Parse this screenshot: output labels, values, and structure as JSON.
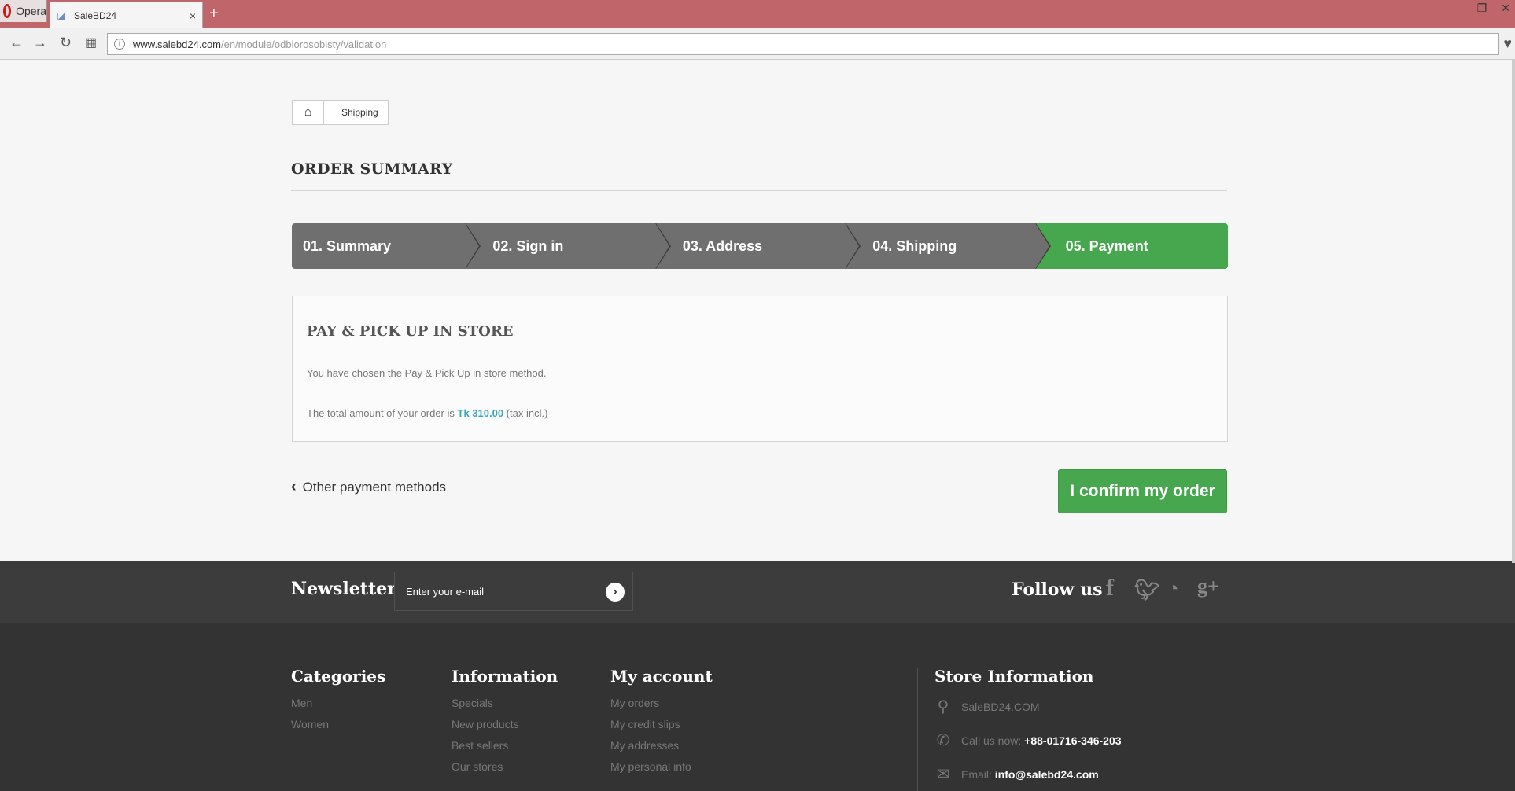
{
  "browser": {
    "app_name": "Opera",
    "tab_title": "SaleBD24",
    "url_host": "www.salebd24.com",
    "url_path": "/en/module/odbiorosobisty/validation"
  },
  "breadcrumb": {
    "current": "Shipping"
  },
  "page": {
    "heading": "ORDER SUMMARY",
    "steps": [
      {
        "label": "01. Summary"
      },
      {
        "label": "02. Sign in"
      },
      {
        "label": "03. Address"
      },
      {
        "label": "04. Shipping"
      },
      {
        "label": "05. Payment"
      }
    ],
    "payment": {
      "title": "PAY & PICK UP IN STORE",
      "text": "You have chosen the Pay & Pick Up in store method.",
      "total_prefix": "The total amount of your order is",
      "total_amount": "Tk 310.00",
      "total_suffix": "(tax incl.)"
    },
    "other_methods_label": "Other payment methods",
    "confirm_label": "I confirm my order"
  },
  "newsletter": {
    "title": "Newsletter",
    "placeholder": "Enter your e-mail",
    "follow_title": "Follow us"
  },
  "footer": {
    "categories": {
      "title": "Categories",
      "items": [
        "Men",
        "Women"
      ]
    },
    "information": {
      "title": "Information",
      "items": [
        "Specials",
        "New products",
        "Best sellers",
        "Our stores"
      ]
    },
    "account": {
      "title": "My account",
      "items": [
        "My orders",
        "My credit slips",
        "My addresses",
        "My personal info"
      ]
    },
    "store": {
      "title": "Store Information",
      "name": "SaleBD24.COM",
      "call_label": "Call us now:",
      "phone": "+88-01716-346-203",
      "email_label": "Email:",
      "email": "info@salebd24.com"
    }
  },
  "colors": {
    "accent_green": "#46a74e",
    "step_gray": "#6f6f6f",
    "price_teal": "#3aa7b4",
    "footer_bg": "#333333"
  }
}
